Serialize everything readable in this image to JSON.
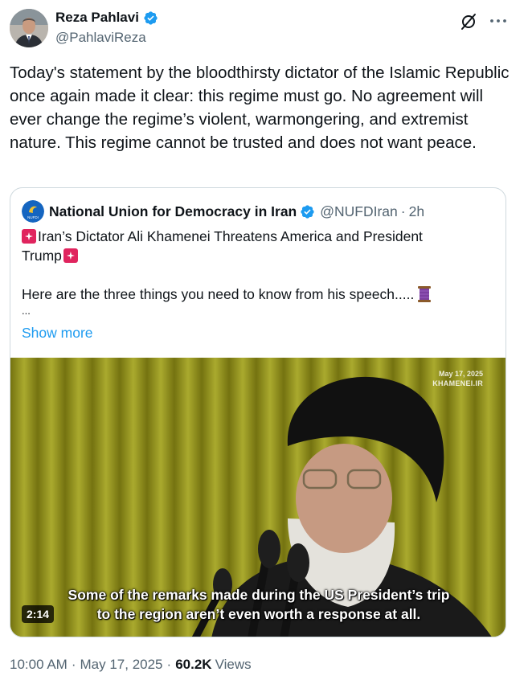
{
  "author": {
    "display_name": "Reza Pahlavi",
    "handle": "@PahlaviReza",
    "verified": true,
    "avatar_icon": "profile-photo"
  },
  "header_actions": {
    "grok_icon": "grok-icon",
    "more_icon": "more-icon"
  },
  "tweet": {
    "text": "Today's statement by the bloodthirsty dictator of the Islamic Republic once again made it clear: this regime must go. No agreement will ever change the regime’s violent, warmongering, and extremist nature. This regime cannot be trusted and does not want peace."
  },
  "quoted_tweet": {
    "display_name": "National Union for Democracy in Iran",
    "handle": "@NUFDIran",
    "separator": "·",
    "time": "2h",
    "verified": true,
    "line1": "Iran’s Dictator Ali Khamenei Threatens America and President",
    "line2": "Trump",
    "line3": "Here are the three things you need to know from his speech.....",
    "ellipsis": "...",
    "show_more": "Show more",
    "media": {
      "watermark_date": "May 17, 2025",
      "watermark_logo": "KHAMENEI.IR",
      "subtitle_line1": "Some of the remarks made during the US President’s trip",
      "subtitle_line2": "to the region aren’t even worth a response at all.",
      "duration": "2:14"
    }
  },
  "meta": {
    "time": "10:00 AM",
    "separator": "·",
    "date": "May 17, 2025",
    "views_count": "60.2K",
    "views_label": "Views"
  },
  "colors": {
    "text_primary": "#0f1419",
    "text_secondary": "#536471",
    "link_blue": "#1d9bf0",
    "border": "#cfd9de",
    "siren_red": "#e0245e",
    "curtain_olive": "#9a9a1e"
  }
}
